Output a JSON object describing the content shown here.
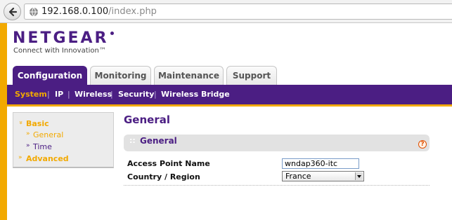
{
  "browser": {
    "url_host": "192.168.0.100",
    "url_path": "/index.php"
  },
  "brand": {
    "logo_text": "NETGEAR",
    "tagline": "Connect with Innovation™",
    "accent_color": "#4b1e83",
    "highlight_color": "#f2a900"
  },
  "tabs": [
    {
      "label": "Configuration",
      "active": true
    },
    {
      "label": "Monitoring",
      "active": false
    },
    {
      "label": "Maintenance",
      "active": false
    },
    {
      "label": "Support",
      "active": false
    }
  ],
  "subnav": [
    {
      "label": "System",
      "active": true
    },
    {
      "label": "IP",
      "active": false
    },
    {
      "label": "Wireless",
      "active": false
    },
    {
      "label": "Security",
      "active": false
    },
    {
      "label": "Wireless Bridge",
      "active": false
    }
  ],
  "subnav_separator": "|",
  "side_menu": {
    "basic": {
      "label": "Basic",
      "marker": "»"
    },
    "general": {
      "label": "General",
      "marker": "»"
    },
    "time": {
      "label": "Time",
      "marker": "»"
    },
    "advanced": {
      "label": "Advanced",
      "marker": "»"
    }
  },
  "main": {
    "title": "General",
    "section_title": "General",
    "help_glyph": "?",
    "section_handle": "::",
    "fields": {
      "ap_name_label": "Access Point Name",
      "ap_name_value": "wndap360-itc",
      "country_label": "Country / Region",
      "country_value": "France"
    }
  },
  "icons": {
    "back": "back-arrow-icon",
    "site": "globe-icon",
    "help": "help-icon",
    "dropdown": "chevron-down-icon"
  }
}
